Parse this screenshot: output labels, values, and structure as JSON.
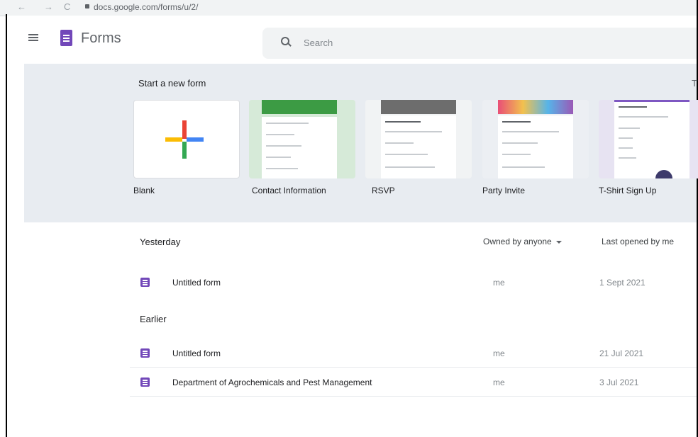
{
  "browser": {
    "url": "docs.google.com/forms/u/2/",
    "back": "←",
    "forward": "→",
    "reload": "C"
  },
  "header": {
    "app_title": "Forms",
    "search_placeholder": "Search"
  },
  "gallery": {
    "title": "Start a new form",
    "right_label": "T",
    "templates": [
      {
        "label": "Blank",
        "thumb": "blank-plus"
      },
      {
        "label": "Contact Information",
        "thumb": "green",
        "color": "#3c9b44"
      },
      {
        "label": "RSVP",
        "thumb": "photo",
        "color": "#8a8a8a"
      },
      {
        "label": "Party Invite",
        "thumb": "colorful",
        "color": "#c94f8f"
      },
      {
        "label": "T-Shirt Sign Up",
        "thumb": "purple",
        "color": "#7e57c2"
      }
    ],
    "plus_colors": {
      "blue": "#4285f4",
      "red": "#ea4335",
      "yellow": "#fbbc04",
      "green": "#34a853"
    }
  },
  "list": {
    "sections": [
      {
        "title": "Yesterday"
      },
      {
        "title": "Earlier"
      }
    ],
    "owner_filter": "Owned by anyone",
    "sort_label": "Last opened by me",
    "rows": [
      {
        "name": "Untitled form",
        "owner": "me",
        "date": "1 Sept 2021"
      },
      {
        "name": "Untitled form",
        "owner": "me",
        "date": "21 Jul 2021"
      },
      {
        "name": "Department of Agrochemicals and Pest Management",
        "owner": "me",
        "date": "3 Jul 2021"
      }
    ]
  },
  "icons": {
    "menu": "hamburger-icon",
    "logo": "forms-logo-icon",
    "search": "search-icon",
    "form": "form-icon"
  }
}
